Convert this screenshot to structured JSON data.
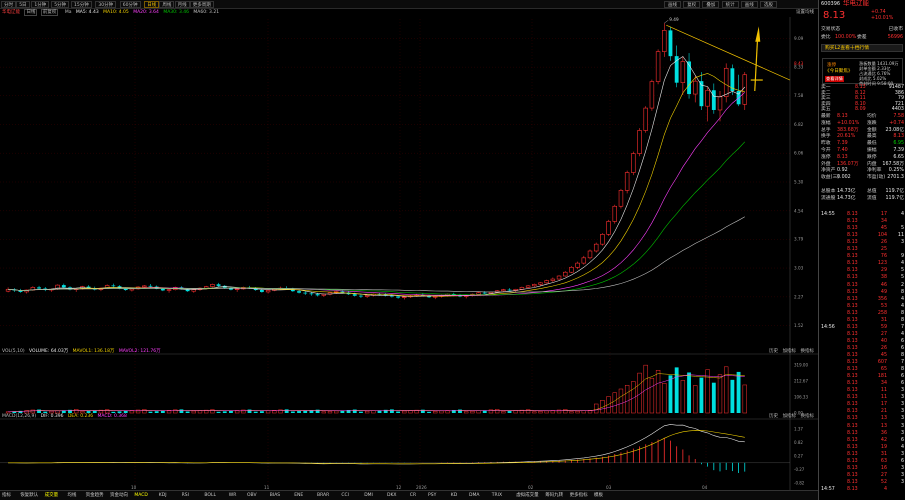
{
  "toolbar": {
    "left_buttons": [
      "分时",
      "5日",
      "1分钟",
      "5分钟",
      "15分钟",
      "30分钟",
      "60分钟",
      "日线",
      "周线",
      "月线",
      "更多周期"
    ],
    "selected_index": 7,
    "right_buttons": [
      "画线",
      "复权",
      "叠加",
      "统计",
      "画线",
      "选股"
    ],
    "stock_code": "600396",
    "stock_name": "华电辽能"
  },
  "main_indicator": {
    "name": "华电辽能",
    "tag1": "日线",
    "tag2": "前复权",
    "ma_label": "Ma",
    "ma5": "MA5: 4.43",
    "ma10": "MA10: 4.05",
    "ma20": "MA20: 3.64",
    "ma30": "MA30: 3.46",
    "ma60": "MA60: 3.21",
    "right_setting": "设置均线"
  },
  "volume_indicator": {
    "name": "VOL(5,10)",
    "volume": "VOLUME: 64.03万",
    "ma1": "MAVOL1: 136.18万",
    "ma2": "MAVOL2: 121.76万",
    "right_btns": [
      "历史",
      "加指标",
      "换指标"
    ]
  },
  "macd_indicator": {
    "name": "MACD(12,26,9)",
    "dif": "DIF: 0.396",
    "dea": "DEA: 0.236",
    "macd": "MACD: 0.368",
    "right_btns": [
      "历史",
      "加指标",
      "换指标"
    ]
  },
  "colors": {
    "up": "#ff3030",
    "down": "#00e0e0",
    "ma5": "#e8e8e8",
    "ma10": "#f0d000",
    "ma20": "#ff40ff",
    "ma30": "#00c000",
    "ma60": "#c0c0c0",
    "grid": "#3a0000",
    "annotation": "#f0c000"
  },
  "chart_data": {
    "type": "candlestick",
    "price_axis": [
      "9.09",
      "8.33",
      "7.58",
      "6.82",
      "6.06",
      "5.30",
      "4.54",
      "3.79",
      "3.03",
      "2.27",
      "1.52"
    ],
    "price_ylim": [
      1.0,
      9.6
    ],
    "time_axis": [
      "10",
      "11",
      "12",
      "2026",
      "02",
      "03",
      "04"
    ],
    "high_label": "9.49",
    "price_peak_label": "8.43",
    "volume_axis": [
      "319.00",
      "212.67",
      "106.33",
      "0.00"
    ],
    "volume_unit": "万",
    "macd_axis": [
      "1.37",
      "0.82",
      "0.27",
      "-0.27",
      "-0.82",
      "-1.37"
    ],
    "volume_ylim": [
      0,
      340
    ],
    "macd_ylim": [
      -0.9,
      1.45
    ],
    "ohlc": [
      [
        2.42,
        2.52,
        2.39,
        2.47
      ],
      [
        2.47,
        2.5,
        2.4,
        2.44
      ],
      [
        2.44,
        2.48,
        2.38,
        2.4
      ],
      [
        2.4,
        2.46,
        2.36,
        2.45
      ],
      [
        2.45,
        2.55,
        2.43,
        2.52
      ],
      [
        2.52,
        2.56,
        2.46,
        2.49
      ],
      [
        2.49,
        2.53,
        2.42,
        2.45
      ],
      [
        2.45,
        2.49,
        2.4,
        2.47
      ],
      [
        2.47,
        2.6,
        2.45,
        2.58
      ],
      [
        2.58,
        2.62,
        2.5,
        2.52
      ],
      [
        2.52,
        2.55,
        2.44,
        2.46
      ],
      [
        2.46,
        2.5,
        2.4,
        2.48
      ],
      [
        2.48,
        2.56,
        2.46,
        2.54
      ],
      [
        2.54,
        2.58,
        2.48,
        2.5
      ],
      [
        2.5,
        2.54,
        2.44,
        2.46
      ],
      [
        2.46,
        2.52,
        2.42,
        2.5
      ],
      [
        2.5,
        2.6,
        2.48,
        2.57
      ],
      [
        2.57,
        2.62,
        2.52,
        2.55
      ],
      [
        2.55,
        2.58,
        2.47,
        2.49
      ],
      [
        2.49,
        2.52,
        2.43,
        2.45
      ],
      [
        2.45,
        2.5,
        2.41,
        2.48
      ],
      [
        2.48,
        2.55,
        2.46,
        2.53
      ],
      [
        2.53,
        2.58,
        2.5,
        2.56
      ],
      [
        2.56,
        2.61,
        2.52,
        2.54
      ],
      [
        2.54,
        2.57,
        2.47,
        2.48
      ],
      [
        2.48,
        2.52,
        2.42,
        2.44
      ],
      [
        2.44,
        2.48,
        2.38,
        2.46
      ],
      [
        2.46,
        2.54,
        2.44,
        2.52
      ],
      [
        2.52,
        2.55,
        2.46,
        2.47
      ],
      [
        2.47,
        2.5,
        2.4,
        2.42
      ],
      [
        2.42,
        2.48,
        2.38,
        2.46
      ],
      [
        2.46,
        2.52,
        2.43,
        2.5
      ],
      [
        2.5,
        2.56,
        2.48,
        2.54
      ],
      [
        2.54,
        2.62,
        2.52,
        2.6
      ],
      [
        2.6,
        2.64,
        2.54,
        2.56
      ],
      [
        2.56,
        2.58,
        2.48,
        2.5
      ],
      [
        2.5,
        2.54,
        2.44,
        2.46
      ],
      [
        2.46,
        2.5,
        2.4,
        2.48
      ],
      [
        2.48,
        2.54,
        2.46,
        2.52
      ],
      [
        2.52,
        2.56,
        2.48,
        2.5
      ],
      [
        2.5,
        2.53,
        2.43,
        2.45
      ],
      [
        2.45,
        2.48,
        2.38,
        2.4
      ],
      [
        2.4,
        2.46,
        2.36,
        2.44
      ],
      [
        2.44,
        2.5,
        2.42,
        2.48
      ],
      [
        2.48,
        2.54,
        2.45,
        2.5
      ],
      [
        2.5,
        2.55,
        2.46,
        2.47
      ],
      [
        2.47,
        2.51,
        2.4,
        2.42
      ],
      [
        2.42,
        2.46,
        2.36,
        2.38
      ],
      [
        2.38,
        2.42,
        2.32,
        2.36
      ],
      [
        2.36,
        2.4,
        2.3,
        2.34
      ],
      [
        2.34,
        2.38,
        2.28,
        2.31
      ],
      [
        2.31,
        2.36,
        2.27,
        2.34
      ],
      [
        2.34,
        2.4,
        2.31,
        2.38
      ],
      [
        2.38,
        2.44,
        2.35,
        2.41
      ],
      [
        2.41,
        2.45,
        2.36,
        2.38
      ],
      [
        2.38,
        2.42,
        2.32,
        2.34
      ],
      [
        2.34,
        2.38,
        2.28,
        2.3
      ],
      [
        2.3,
        2.34,
        2.24,
        2.28
      ],
      [
        2.28,
        2.33,
        2.24,
        2.31
      ],
      [
        2.31,
        2.36,
        2.28,
        2.34
      ],
      [
        2.34,
        2.38,
        2.3,
        2.33
      ],
      [
        2.33,
        2.37,
        2.28,
        2.3
      ],
      [
        2.3,
        2.34,
        2.25,
        2.28
      ],
      [
        2.28,
        2.31,
        2.22,
        2.25
      ],
      [
        2.25,
        2.29,
        2.2,
        2.27
      ],
      [
        2.27,
        2.32,
        2.24,
        2.3
      ],
      [
        2.3,
        2.35,
        2.27,
        2.32
      ],
      [
        2.32,
        2.36,
        2.28,
        2.3
      ],
      [
        2.3,
        2.33,
        2.24,
        2.26
      ],
      [
        2.26,
        2.3,
        2.21,
        2.28
      ],
      [
        2.28,
        2.33,
        2.25,
        2.31
      ],
      [
        2.31,
        2.36,
        2.28,
        2.34
      ],
      [
        2.34,
        2.38,
        2.3,
        2.32
      ],
      [
        2.32,
        2.35,
        2.26,
        2.28
      ],
      [
        2.28,
        2.32,
        2.23,
        2.3
      ],
      [
        2.3,
        2.36,
        2.28,
        2.34
      ],
      [
        2.34,
        2.4,
        2.32,
        2.38
      ],
      [
        2.38,
        2.42,
        2.34,
        2.36
      ],
      [
        2.36,
        2.4,
        2.32,
        2.39
      ],
      [
        2.39,
        2.45,
        2.37,
        2.43
      ],
      [
        2.43,
        2.48,
        2.4,
        2.46
      ],
      [
        2.46,
        2.5,
        2.42,
        2.44
      ],
      [
        2.44,
        2.48,
        2.4,
        2.47
      ],
      [
        2.47,
        2.54,
        2.45,
        2.52
      ],
      [
        2.52,
        2.58,
        2.5,
        2.56
      ],
      [
        2.56,
        2.62,
        2.53,
        2.6
      ],
      [
        2.6,
        2.66,
        2.57,
        2.64
      ],
      [
        2.64,
        2.72,
        2.62,
        2.7
      ],
      [
        2.7,
        2.78,
        2.66,
        2.74
      ],
      [
        2.74,
        2.84,
        2.72,
        2.82
      ],
      [
        2.82,
        2.95,
        2.8,
        2.92
      ],
      [
        2.92,
        3.08,
        2.9,
        3.05
      ],
      [
        3.05,
        3.2,
        3.0,
        3.16
      ],
      [
        3.16,
        3.35,
        3.12,
        3.3
      ],
      [
        3.3,
        3.52,
        3.26,
        3.48
      ],
      [
        3.48,
        3.7,
        3.44,
        3.66
      ],
      [
        3.66,
        3.95,
        3.62,
        3.92
      ],
      [
        3.92,
        4.3,
        3.88,
        4.26
      ],
      [
        4.26,
        4.7,
        4.2,
        4.66
      ],
      [
        4.66,
        5.12,
        4.6,
        5.08
      ],
      [
        5.08,
        5.6,
        5.0,
        5.55
      ],
      [
        5.55,
        6.1,
        5.48,
        6.05
      ],
      [
        6.05,
        6.72,
        5.98,
        6.66
      ],
      [
        6.66,
        7.3,
        6.6,
        7.25
      ],
      [
        7.25,
        8.0,
        7.18,
        7.95
      ],
      [
        7.95,
        8.8,
        7.88,
        8.74
      ],
      [
        8.74,
        9.49,
        8.6,
        9.3
      ],
      [
        9.3,
        9.4,
        8.5,
        8.62
      ],
      [
        8.62,
        8.9,
        7.8,
        7.92
      ],
      [
        7.92,
        8.6,
        7.6,
        8.48
      ],
      [
        8.48,
        8.7,
        7.5,
        7.62
      ],
      [
        7.62,
        8.1,
        7.4,
        7.96
      ],
      [
        7.96,
        8.2,
        7.2,
        7.3
      ],
      [
        7.3,
        7.8,
        6.9,
        7.72
      ],
      [
        7.72,
        7.9,
        7.1,
        7.2
      ],
      [
        7.2,
        7.7,
        6.9,
        7.55
      ],
      [
        7.55,
        8.43,
        7.4,
        8.3
      ],
      [
        8.3,
        8.4,
        7.6,
        7.7
      ],
      [
        7.7,
        8.13,
        7.3,
        7.35
      ],
      [
        7.35,
        8.2,
        7.2,
        8.13
      ]
    ],
    "volume": [],
    "macd_hist": []
  }
}
